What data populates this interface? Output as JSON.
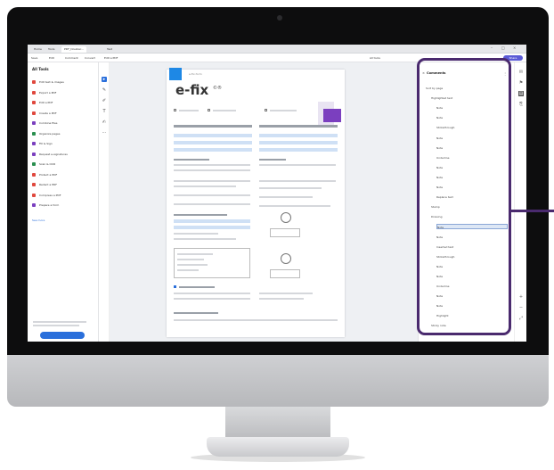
{
  "browser": {
    "tabs": [
      "Home",
      "Tools",
      "PDF_Doubler...",
      "Test"
    ],
    "menu": [
      "Save",
      "Edit",
      "Comment",
      "Convert",
      "Edit a PDF",
      "All tools"
    ],
    "share_label": "Share"
  },
  "tools_panel": {
    "title": "All Tools",
    "items": [
      {
        "label": "Edit text & images",
        "color": "#e0483e"
      },
      {
        "label": "Export a PDF",
        "color": "#e0483e"
      },
      {
        "label": "Edit a PDF",
        "color": "#e0483e"
      },
      {
        "label": "Create a PDF",
        "color": "#e0483e"
      },
      {
        "label": "Combine files",
        "color": "#7b3fbf"
      },
      {
        "label": "Organize pages",
        "color": "#2a8f4f"
      },
      {
        "label": "Fill & Sign",
        "color": "#7b3fbf"
      },
      {
        "label": "Request e-signatures",
        "color": "#7b3fbf"
      },
      {
        "label": "Scan & OCR",
        "color": "#2a8f4f"
      },
      {
        "label": "Protect a PDF",
        "color": "#e0483e"
      },
      {
        "label": "Redact a PDF",
        "color": "#e0483e"
      },
      {
        "label": "Compress a PDF",
        "color": "#e0483e"
      },
      {
        "label": "Prepare a form",
        "color": "#7b3fbf"
      }
    ],
    "see_more": "See more"
  },
  "document": {
    "header": "e-fix-form",
    "logo": "e-fix",
    "logo_sup": "©®"
  },
  "comments": {
    "title": "Comments",
    "items": [
      {
        "label": "Sort by page",
        "indent": 0,
        "selected": false
      },
      {
        "label": "Highlighted text",
        "indent": 1,
        "selected": false
      },
      {
        "label": "Note",
        "indent": 2,
        "selected": false
      },
      {
        "label": "Note",
        "indent": 2,
        "selected": false
      },
      {
        "label": "Strikethrough",
        "indent": 2,
        "selected": false
      },
      {
        "label": "Note",
        "indent": 2,
        "selected": false
      },
      {
        "label": "Note",
        "indent": 2,
        "selected": false
      },
      {
        "label": "Underline",
        "indent": 2,
        "selected": false
      },
      {
        "label": "Note",
        "indent": 2,
        "selected": false
      },
      {
        "label": "Note",
        "indent": 2,
        "selected": false
      },
      {
        "label": "Note",
        "indent": 2,
        "selected": false
      },
      {
        "label": "Replace text",
        "indent": 2,
        "selected": false
      },
      {
        "label": "Stamp",
        "indent": 1,
        "selected": false
      },
      {
        "label": "Drawing",
        "indent": 1,
        "selected": false
      },
      {
        "label": "Note",
        "indent": 2,
        "selected": true
      },
      {
        "label": "Note",
        "indent": 2,
        "selected": false
      },
      {
        "label": "Inserted text",
        "indent": 2,
        "selected": false
      },
      {
        "label": "Strikethrough",
        "indent": 2,
        "selected": false
      },
      {
        "label": "Note",
        "indent": 2,
        "selected": false
      },
      {
        "label": "Note",
        "indent": 2,
        "selected": false
      },
      {
        "label": "Underline",
        "indent": 2,
        "selected": false
      },
      {
        "label": "Note",
        "indent": 2,
        "selected": false
      },
      {
        "label": "Note",
        "indent": 2,
        "selected": false
      },
      {
        "label": "Highlight",
        "indent": 2,
        "selected": false
      },
      {
        "label": "Sticky note",
        "indent": 1,
        "selected": false
      }
    ]
  },
  "colors": {
    "highlight": "#4a2a6e",
    "accent": "#2a6fdb",
    "brand": "#7b3fbf"
  }
}
